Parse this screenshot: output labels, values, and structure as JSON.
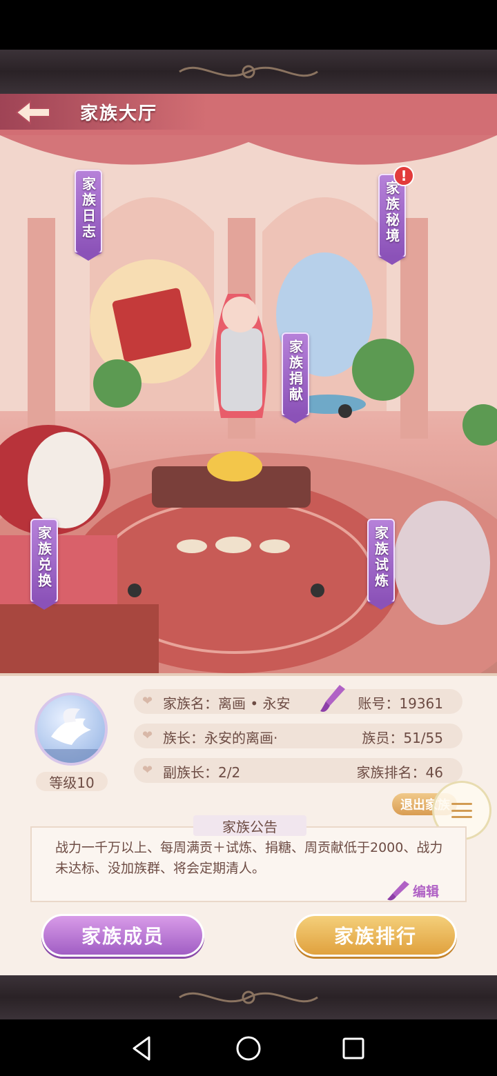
{
  "header": {
    "title": "家族大厅"
  },
  "hall_banners": {
    "log": "家族日志",
    "secret_realm": "家族秘境",
    "donate": "家族捐献",
    "exchange": "家族兑换",
    "trial": "家族试炼",
    "alert_mark": "!"
  },
  "family_info": {
    "level": "等级10",
    "name_label": "家族名：",
    "name_value": "离画 • 永安",
    "account_label": "账号：",
    "account_value": "19361",
    "leader_label": "族长：",
    "leader_value": "永安的离画·",
    "members_label": "族员：",
    "members_value": "51/55",
    "vice_label": "副族长：",
    "vice_value": "2/2",
    "rank_label": "家族排名：",
    "rank_value": "46"
  },
  "actions": {
    "exit_label": "退出家族",
    "edit_label": "编辑",
    "members_button": "家族成员",
    "ranking_button": "家族排行"
  },
  "notice": {
    "title": "家族公告",
    "text": "战力一千万以上、每周满贡＋试炼、捐糖、周贡献低于2000、战力未达标、没加族群、将会定期清人。"
  },
  "colors": {
    "purple_banner": "#9b62c6",
    "gold_button": "#e8b04f",
    "text_brown": "#6d4c44",
    "alert_red": "#e23b3b"
  },
  "icons": [
    "back-arrow-icon",
    "heart-icon",
    "brush-icon",
    "menu-icon",
    "dove-emblem-icon",
    "nav-back-icon",
    "nav-home-icon",
    "nav-recents-icon"
  ]
}
